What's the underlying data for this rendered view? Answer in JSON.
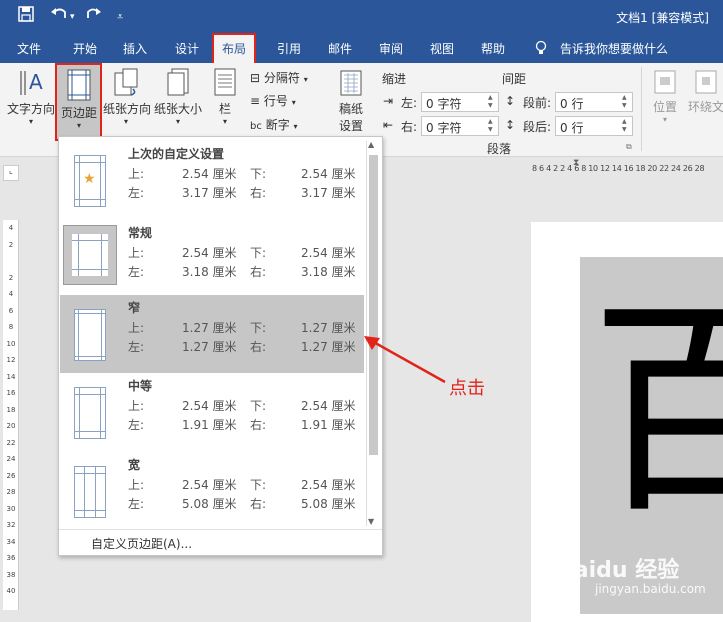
{
  "window": {
    "title": "文档1 [兼容模式]"
  },
  "quick_access": {
    "save_icon": "save-icon",
    "undo_icon": "undo-icon",
    "redo_icon": "redo-icon",
    "customize_icon": "customize-icon"
  },
  "tabs": [
    "文件",
    "开始",
    "插入",
    "设计",
    "布局",
    "引用",
    "邮件",
    "审阅",
    "视图",
    "帮助"
  ],
  "active_tab": "布局",
  "tell_me": "告诉我你想要做什么",
  "ribbon": {
    "text_direction": "文字方向",
    "margins": "页边距",
    "orientation": "纸张方向",
    "size": "纸张大小",
    "columns": "栏",
    "breaks": "分隔符",
    "line_numbers": "行号",
    "hyphenation": "断字",
    "draft_line1": "稿纸",
    "draft_line2": "设置",
    "indent_title": "缩进",
    "spacing_title": "间距",
    "indent_left_label": "左:",
    "indent_left_value": "0 字符",
    "indent_right_label": "右:",
    "indent_right_value": "0 字符",
    "space_before_label": "段前:",
    "space_before_value": "0 行",
    "space_after_label": "段后:",
    "space_after_value": "0 行",
    "paragraph_group": "段落",
    "position": "位置",
    "wrap_text": "环绕文"
  },
  "ruler_h_text": "8 6 4 2    2 4 6 8 10 12 14 16 18 20 22 24 26 28",
  "ruler_v_marks": [
    "4",
    "2",
    "",
    "2",
    "4",
    "6",
    "8",
    "10",
    "12",
    "14",
    "16",
    "18",
    "20",
    "22",
    "24",
    "26",
    "28",
    "30",
    "32",
    "34",
    "36",
    "38",
    "40"
  ],
  "menu": {
    "options": [
      {
        "name": "上次的自定义设置",
        "top_label": "上:",
        "top": "2.54 厘米",
        "bottom_label": "下:",
        "bottom": "2.54 厘米",
        "left_label": "左:",
        "left": "3.17 厘米",
        "right_label": "右:",
        "right": "3.17 厘米",
        "icon": "star-page-icon"
      },
      {
        "name": "常规",
        "top_label": "上:",
        "top": "2.54 厘米",
        "bottom_label": "下:",
        "bottom": "2.54 厘米",
        "left_label": "左:",
        "left": "3.18 厘米",
        "right_label": "右:",
        "right": "3.18 厘米",
        "icon": "normal-margins-icon"
      },
      {
        "name": "窄",
        "top_label": "上:",
        "top": "1.27 厘米",
        "bottom_label": "下:",
        "bottom": "1.27 厘米",
        "left_label": "左:",
        "left": "1.27 厘米",
        "right_label": "右:",
        "right": "1.27 厘米",
        "icon": "narrow-margins-icon"
      },
      {
        "name": "中等",
        "top_label": "上:",
        "top": "2.54 厘米",
        "bottom_label": "下:",
        "bottom": "2.54 厘米",
        "left_label": "左:",
        "left": "1.91 厘米",
        "right_label": "右:",
        "right": "1.91 厘米",
        "icon": "moderate-margins-icon"
      },
      {
        "name": "宽",
        "top_label": "上:",
        "top": "2.54 厘米",
        "bottom_label": "下:",
        "bottom": "2.54 厘米",
        "left_label": "左:",
        "left": "5.08 厘米",
        "right_label": "右:",
        "right": "5.08 厘米",
        "icon": "wide-margins-icon"
      }
    ],
    "selected": "窄",
    "custom": "自定义页边距(A)..."
  },
  "annotation": "点击",
  "doc_char": "百",
  "watermark": {
    "brand": "Baidu 经验",
    "url": "jingyan.baidu.com"
  },
  "colors": {
    "accent": "#2b579a",
    "highlight_red": "#e2231a"
  }
}
